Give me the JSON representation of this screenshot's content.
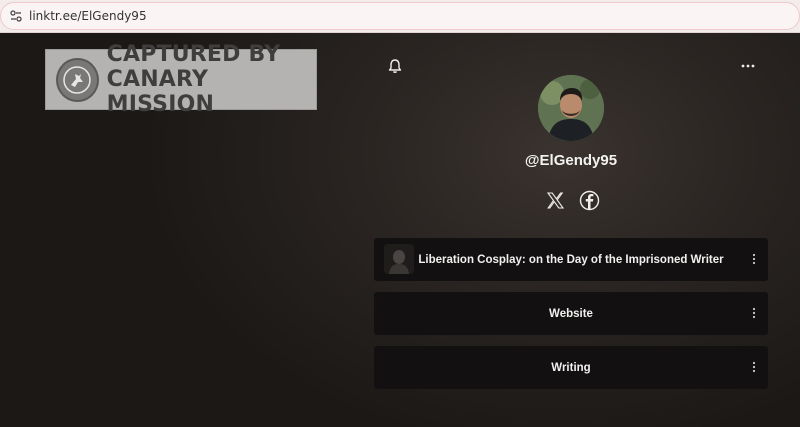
{
  "browser": {
    "url": "linktr.ee/ElGendy95",
    "site_settings_icon": "site-settings-icon"
  },
  "watermark": {
    "line1": "CAPTURED BY",
    "line2": "CANARY MISSION",
    "logo_icon": "bird-logo-icon"
  },
  "profile": {
    "handle": "@ElGendy95",
    "notification_icon": "bell-icon",
    "more_icon": "more-horizontal-icon",
    "socials": [
      {
        "icon": "x-twitter-icon"
      },
      {
        "icon": "facebook-icon"
      }
    ]
  },
  "links": [
    {
      "label": "Liberation Cosplay: on the Day of the Imprisoned Writer",
      "has_thumbnail": true
    },
    {
      "label": "Website",
      "has_thumbnail": false
    },
    {
      "label": "Writing",
      "has_thumbnail": false
    }
  ],
  "colors": {
    "background": "#2a2522",
    "card": "#121010",
    "text": "#f4f2f1"
  }
}
